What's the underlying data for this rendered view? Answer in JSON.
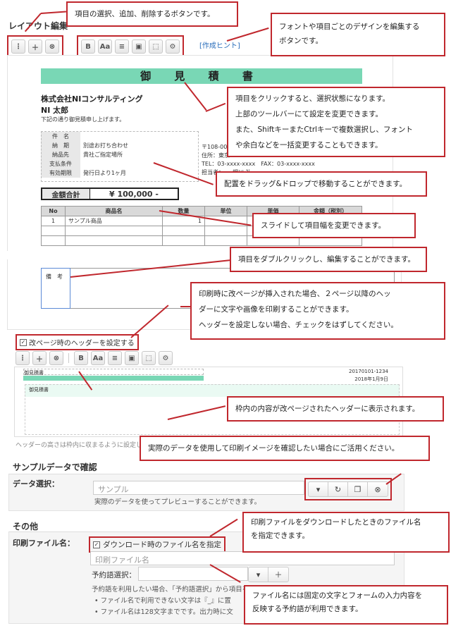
{
  "layout_edit": {
    "title": "レイアウト編集",
    "hint_link": "[作成ヒント]",
    "toolbar1_icons": [
      "menu-icon",
      "plus-icon",
      "delete-icon"
    ],
    "toolbar2_icons": [
      "bold-icon",
      "font-size-icon",
      "align-icon",
      "frame-icon",
      "border-icon",
      "gear-icon"
    ]
  },
  "document": {
    "title": "御 見 積 書",
    "company": "株式会社NIコンサルティング",
    "person": "NI 太郎",
    "greeting": "下記の通り御見積申し上げます。",
    "info": [
      {
        "label": "件　名",
        "value": ""
      },
      {
        "label": "納　期",
        "value": "別途お打ち合わせ"
      },
      {
        "label": "納品先",
        "value": "貴社ご指定場所"
      },
      {
        "label": "支払条件",
        "value": ""
      },
      {
        "label": "有効期限",
        "value": "発行日より1ヶ月"
      }
    ],
    "sender_head": "株",
    "sender_zip": "〒108-00",
    "sender_addr": "住所：東京",
    "sender_tel": "TEL：03-xxxx-xxxx　FAX：03-xxxx-xxxx",
    "sender_rep": "担当者：　　相川 礼",
    "total_label": "金額合計",
    "total_value": "¥ 100,000 -",
    "columns": [
      "No",
      "商品名",
      "数量",
      "単位",
      "単価",
      "金額（税別）"
    ],
    "rows": [
      [
        "1",
        "サンプル商品",
        "1",
        "",
        "",
        ""
      ]
    ],
    "remarks_label": "備　考"
  },
  "header_settings": {
    "checkbox_label": "改ページ時のヘッダーを設定する",
    "preview_left": "御見積書",
    "preview_right_1": "20170101-1234",
    "preview_right_2": "2018年1月9日",
    "preview_sub": "御見積書",
    "note": "ヘッダーの高さは枠内に収まるように設定し"
  },
  "sample_data": {
    "title": "サンプルデータで確認",
    "select_label": "データ選択：",
    "placeholder": "サンプル",
    "help": "実際のデータを使ってプレビューすることができます。"
  },
  "other": {
    "title": "その他",
    "filename_label": "印刷ファイル名：",
    "checkbox_label": "ダウンロード時のファイル名を指定",
    "filename_placeholder": "印刷ファイル名",
    "reserved_label": "予約語選択：",
    "reserved_help": "予約語を利用したい場合、「予約語選択」から項目を選択し＋ボタンを押してください。",
    "bullet1": "ファイル名で利用できない文字は『_』に置",
    "bullet2": "ファイル名は128文字までです。出力時に文"
  },
  "callouts": {
    "c1": "項目の選択、追加、削除するボタンです。",
    "c2_1": "フォントや項目ごとのデザインを編集する",
    "c2_2": "ボタンです。",
    "c3_1": "項目をクリックすると、選択状態になります。",
    "c3_2": "上部のツールバーにて設定を変更できます。",
    "c3_3": "また、ShiftキーまたCtrlキーで複数選択し、フォント",
    "c3_4": "や余白などを一括変更することもできます。",
    "c4": "配置をドラッグ&ドロップで移動することができます。",
    "c5": "スライドして項目幅を変更できます。",
    "c6": "項目をダブルクリックし、編集することができます。",
    "c7_1": "印刷時に改ページが挿入された場合、２ページ以降のヘッ",
    "c7_2": "ダーに文字や画像を印刷することができます。",
    "c7_3": "ヘッダーを設定しない場合、チェックをはずしてください。",
    "c8": "枠内の内容が改ページされたヘッダーに表示されます。",
    "c9": "実際のデータを使用して印刷イメージを確認したい場合にご活用ください。",
    "c10_1": "印刷ファイルをダウンロードしたときのファイル名",
    "c10_2": "を指定できます。",
    "c11_1": "ファイル名には固定の文字とフォームの入力内容を",
    "c11_2": "反映する予約語が利用できます。"
  }
}
